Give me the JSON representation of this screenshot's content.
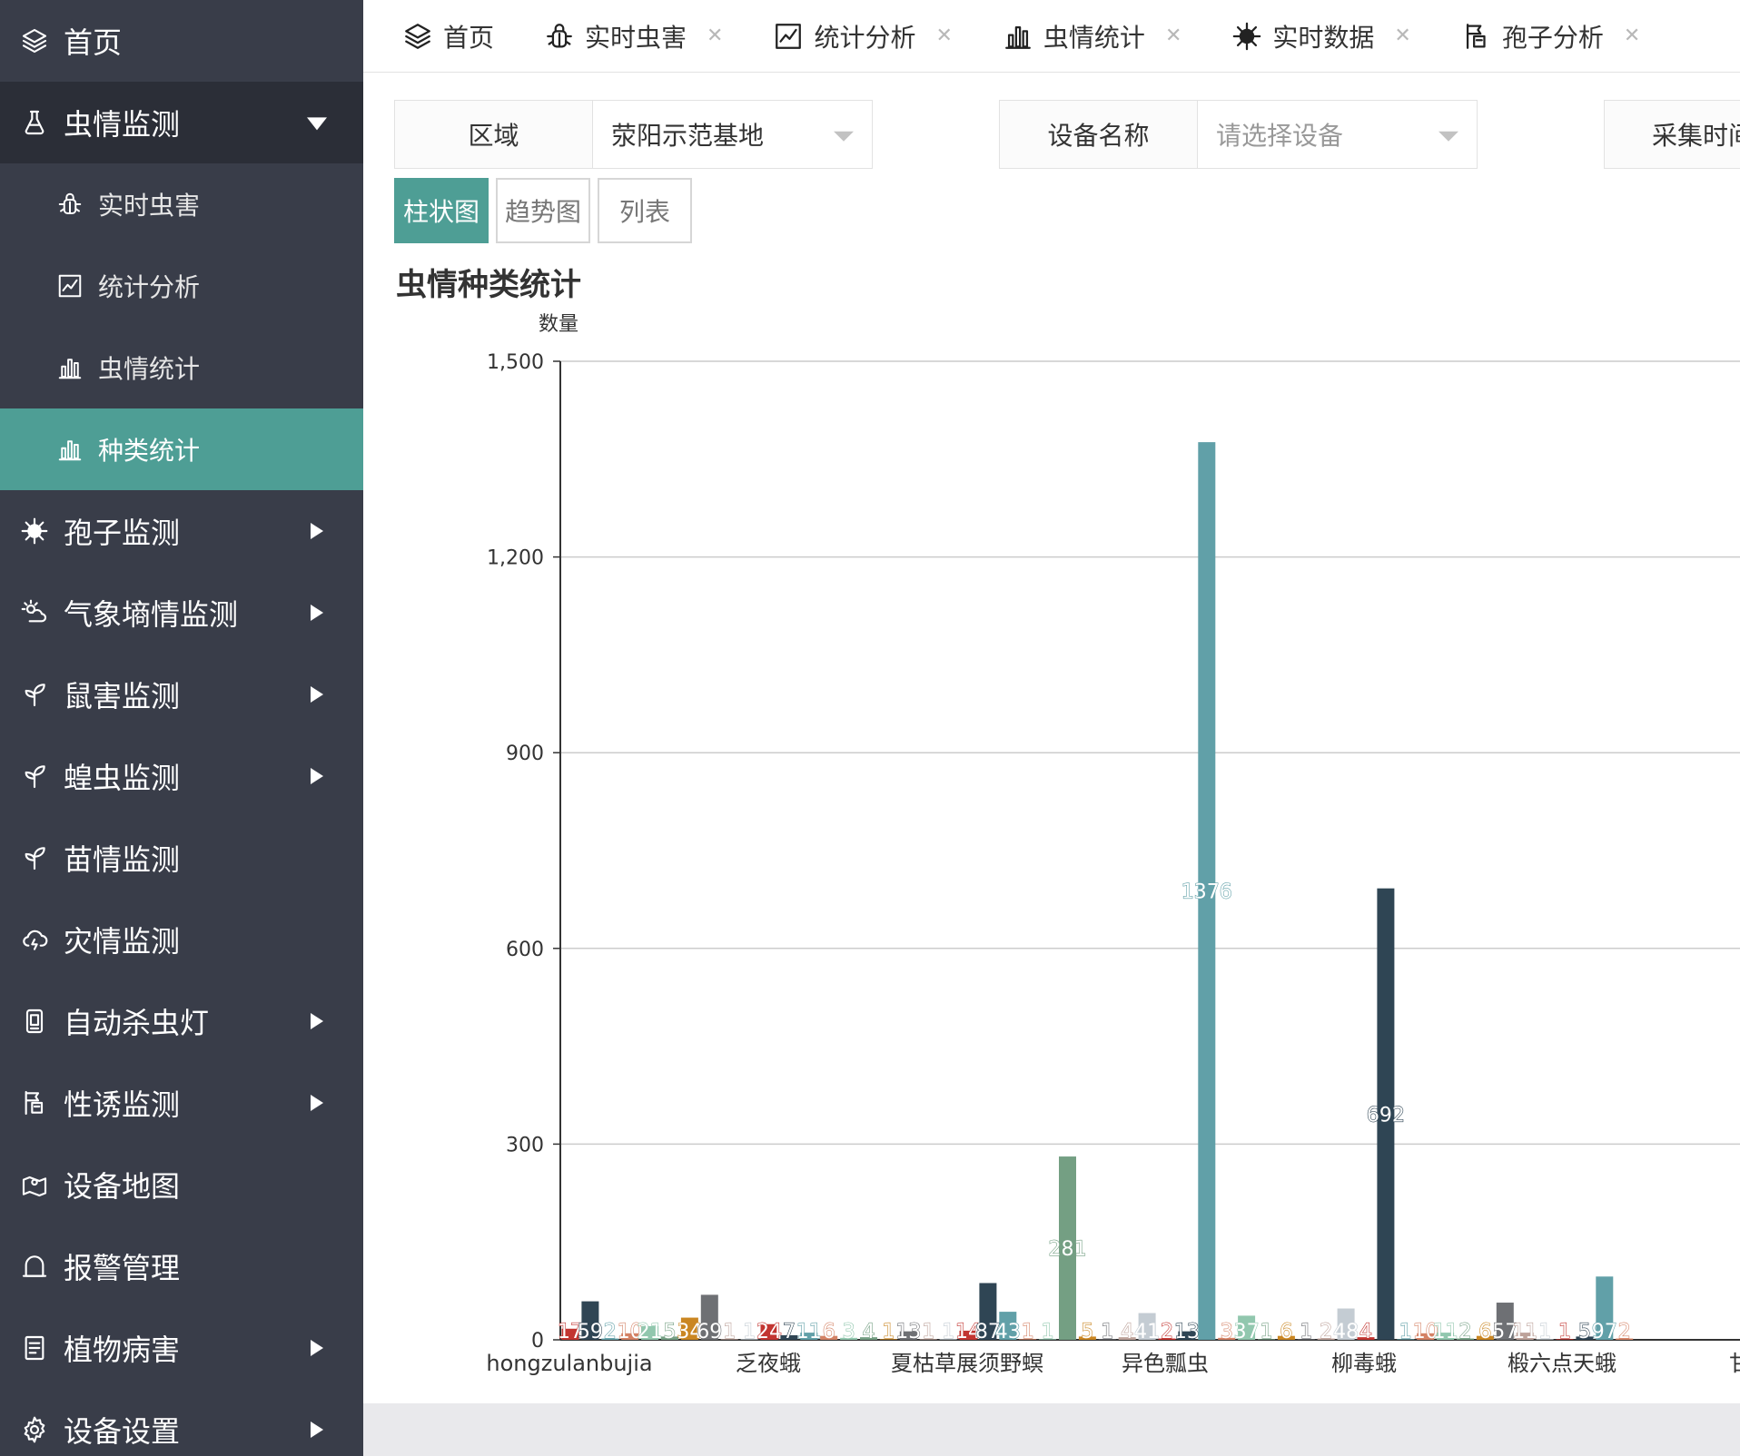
{
  "sidebar": {
    "items": [
      {
        "label": "首页",
        "icon": "layers-icon",
        "arrow": ""
      },
      {
        "label": "虫情监测",
        "icon": "bug-flask-icon",
        "arrow": "down",
        "open": true,
        "children": [
          {
            "label": "实时虫害",
            "icon": "bug-icon"
          },
          {
            "label": "统计分析",
            "icon": "line-chart-icon"
          },
          {
            "label": "虫情统计",
            "icon": "bar-chart-icon"
          },
          {
            "label": "种类统计",
            "icon": "bar-chart-icon",
            "active": true
          }
        ]
      },
      {
        "label": "孢子监测",
        "icon": "virus-icon",
        "arrow": "right"
      },
      {
        "label": "气象墒情监测",
        "icon": "weather-icon",
        "arrow": "right"
      },
      {
        "label": "鼠害监测",
        "icon": "sprout-icon",
        "arrow": "right"
      },
      {
        "label": "蝗虫监测",
        "icon": "sprout-icon",
        "arrow": "right"
      },
      {
        "label": "苗情监测",
        "icon": "sprout-icon",
        "arrow": ""
      },
      {
        "label": "灾情监测",
        "icon": "cloud-lightning-icon",
        "arrow": ""
      },
      {
        "label": "自动杀虫灯",
        "icon": "lamp-icon",
        "arrow": "right"
      },
      {
        "label": "性诱监测",
        "icon": "trap-icon",
        "arrow": "right"
      },
      {
        "label": "设备地图",
        "icon": "map-pin-icon",
        "arrow": ""
      },
      {
        "label": "报警管理",
        "icon": "bell-icon",
        "arrow": ""
      },
      {
        "label": "植物病害",
        "icon": "document-icon",
        "arrow": "right"
      },
      {
        "label": "设备设置",
        "icon": "gear-icon",
        "arrow": "right"
      }
    ]
  },
  "tabs": [
    {
      "label": "首页",
      "icon": "layers-icon",
      "closable": false
    },
    {
      "label": "实时虫害",
      "icon": "bug-icon",
      "closable": true
    },
    {
      "label": "统计分析",
      "icon": "line-chart-icon",
      "closable": true
    },
    {
      "label": "虫情统计",
      "icon": "bar-chart-icon",
      "closable": true
    },
    {
      "label": "实时数据",
      "icon": "virus-icon",
      "closable": true
    },
    {
      "label": "孢子分析",
      "icon": "trap-icon",
      "closable": true
    }
  ],
  "filters": {
    "region_label": "区域",
    "region_value": "荥阳示范基地",
    "device_label": "设备名称",
    "device_placeholder": "请选择设备",
    "time_label": "采集时间"
  },
  "views": {
    "bar": "柱状图",
    "trend": "趋势图",
    "list": "列表"
  },
  "chart_title": "虫情种类统计",
  "chart_data": {
    "type": "bar",
    "ylabel": "数量",
    "ylim": [
      0,
      1500
    ],
    "yticks": [
      "0",
      "300",
      "600",
      "900",
      "1,200",
      "1,500"
    ],
    "x_tick_labels": [
      "hongzulanbujia",
      "乏夜蛾",
      "夏枯草展须野螟",
      "异色瓢虫",
      "柳毒蛾",
      "椴六点天蛾",
      "甘"
    ],
    "grid": true,
    "values": [
      17,
      59,
      2,
      10,
      21,
      5,
      34,
      69,
      1,
      1,
      24,
      7,
      11,
      6,
      3,
      4,
      1,
      13,
      1,
      1,
      14,
      87,
      43,
      1,
      1,
      281,
      5,
      1,
      4,
      41,
      2,
      13,
      1376,
      3,
      37,
      1,
      6,
      1,
      2,
      48,
      4,
      692,
      1,
      10,
      11,
      2,
      6,
      57,
      11,
      1,
      1,
      5,
      97,
      2
    ],
    "colors": [
      "#c23531",
      "#2f4554",
      "#61a0a8",
      "#d48265",
      "#91c7ae",
      "#749f83",
      "#ca8622",
      "#6e7074",
      "#bda29a",
      "#c4ccd3",
      "#c23531",
      "#2f4554",
      "#61a0a8",
      "#d48265",
      "#91c7ae",
      "#749f83",
      "#ca8622",
      "#6e7074",
      "#bda29a",
      "#c4ccd3",
      "#c23531",
      "#2f4554",
      "#61a0a8",
      "#d48265",
      "#91c7ae",
      "#749f83",
      "#ca8622",
      "#6e7074",
      "#bda29a",
      "#c4ccd3",
      "#c23531",
      "#2f4554",
      "#61a0a8",
      "#d48265",
      "#91c7ae",
      "#749f83",
      "#ca8622",
      "#6e7074",
      "#bda29a",
      "#c4ccd3",
      "#c23531",
      "#2f4554",
      "#61a0a8",
      "#d48265",
      "#91c7ae",
      "#749f83",
      "#ca8622",
      "#6e7074",
      "#bda29a",
      "#c4ccd3",
      "#c23531",
      "#2f4554",
      "#61a0a8",
      "#d48265"
    ]
  },
  "colors": {
    "sidebar_bg": "#393d49",
    "sidebar_open_bg": "#2b2e37",
    "accent": "#4e9e95"
  }
}
